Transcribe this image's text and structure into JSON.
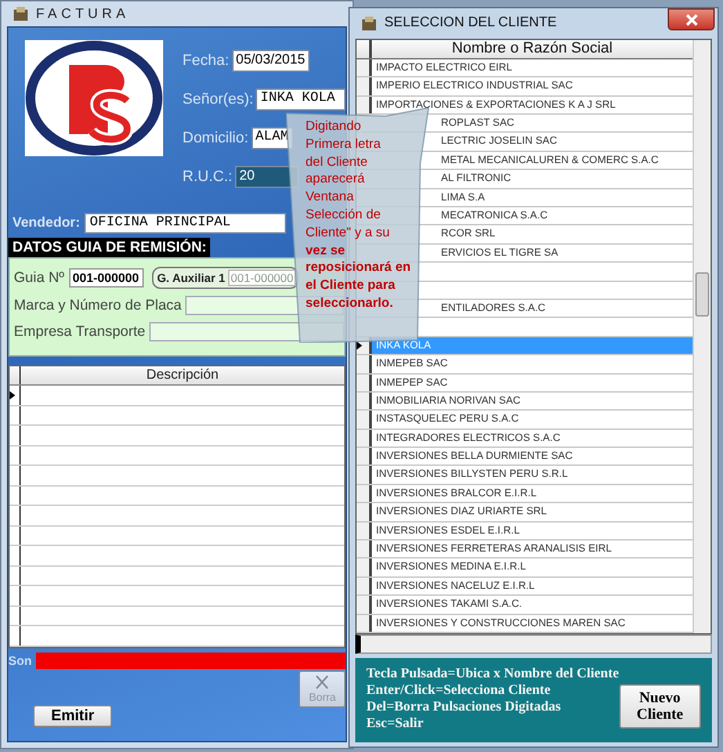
{
  "factura": {
    "title": "FACTURA",
    "fields": [
      {
        "label": "Fecha:",
        "value": "05/03/2015",
        "kind": "date"
      },
      {
        "label": "Señor(es):",
        "value": "INKA KOLA",
        "kind": "mono_wide"
      },
      {
        "label": "Domicilio:",
        "value": "ALAM",
        "kind": "mono"
      },
      {
        "label": "R.U.C.:",
        "value": "20",
        "kind": "highlighted"
      }
    ],
    "vendedor_label": "Vendedor:",
    "vendedor": "OFICINA PRINCIPAL",
    "guia": {
      "title": "DATOS GUIA DE REMISIÓN:",
      "guia_label": "Guia Nº",
      "guia": "001-000000",
      "auxiliar_label": "G. Auxiliar 1",
      "auxiliar": "001-000000",
      "placa_label": "Marca y Número de Placa",
      "transporte_label": "Empresa Transporte"
    },
    "table": {
      "columns": [
        "Descripción"
      ]
    },
    "son_label": "Son",
    "buttons": [
      {
        "label": "Emitir",
        "kind": "text"
      },
      {
        "label": "Borra",
        "kind": "icon"
      }
    ]
  },
  "dialog": {
    "title": "SELECCION DEL CLIENTE",
    "column": "Nombre o Razón Social",
    "rows": [
      {
        "text": "IMPACTO ELECTRICO EIRL",
        "selected": false
      },
      {
        "text": "IMPERIO ELECTRICO INDUSTRIAL SAC",
        "selected": false
      },
      {
        "text": "IMPORTACIONES & EXPORTACIONES K A J SRL",
        "selected": false
      },
      {
        "text": "ROPLAST SAC",
        "selected": false,
        "kind": "partly_hidden"
      },
      {
        "text": "LECTRIC JOSELIN SAC",
        "selected": false,
        "kind": "partly_hidden"
      },
      {
        "text": "METAL MECANICALUREN & COMERC S.A.C",
        "selected": false,
        "kind": "partly_hidden"
      },
      {
        "text": "AL FILTRONIC",
        "selected": false,
        "kind": "partly_hidden"
      },
      {
        "text": "LIMA S.A",
        "selected": false,
        "kind": "partly_hidden"
      },
      {
        "text": "MECATRONICA S.A.C",
        "selected": false,
        "kind": "partly_hidden"
      },
      {
        "text": "RCOR SRL",
        "selected": false,
        "kind": "partly_hidden"
      },
      {
        "text": "ERVICIOS EL TIGRE SA",
        "selected": false,
        "kind": "partly_hidden"
      },
      {
        "selected": false,
        "kind": "partly_hidden"
      },
      {
        "selected": false,
        "kind": "partly_hidden"
      },
      {
        "text": "ENTILADORES S.A.C",
        "selected": false,
        "kind": "partly_hidden"
      },
      {
        "selected": false,
        "kind": "partly_hidden"
      },
      {
        "text": "INKA KOLA",
        "selected": true
      },
      {
        "text": "INMEPEB SAC",
        "selected": false
      },
      {
        "text": "INMEPEP SAC",
        "selected": false
      },
      {
        "text": "INMOBILIARIA NORIVAN SAC",
        "selected": false
      },
      {
        "text": "INSTASQUELEC PERU S.A.C",
        "selected": false
      },
      {
        "text": "INTEGRADORES ELECTRICOS S.A.C",
        "selected": false
      },
      {
        "text": "INVERSIONES BELLA DURMIENTE SAC",
        "selected": false
      },
      {
        "text": "INVERSIONES BILLYSTEN PERU S.R.L",
        "selected": false
      },
      {
        "text": "INVERSIONES BRALCOR E.I.R.L",
        "selected": false
      },
      {
        "text": "INVERSIONES DIAZ URIARTE SRL",
        "selected": false
      },
      {
        "text": "INVERSIONES ESDEL E.I.R.L",
        "selected": false
      },
      {
        "text": "INVERSIONES FERRETERAS ARANALISIS EIRL",
        "selected": false
      },
      {
        "text": "INVERSIONES MEDINA E.I.R.L",
        "selected": false
      },
      {
        "text": "INVERSIONES NACELUZ E.I.R.L",
        "selected": false
      },
      {
        "text": "INVERSIONES TAKAMI S.A.C.",
        "selected": false
      },
      {
        "text": "INVERSIONES Y CONSTRUCCIONES MAREN SAC",
        "selected": false
      }
    ],
    "help_lines": [
      "Tecla Pulsada=Ubica x Nombre del Cliente",
      "Enter/Click=Selecciona Cliente",
      "Del=Borra Pulsaciones Digitadas",
      "Esc=Salir"
    ],
    "new_button": "Nuevo Cliente"
  },
  "callout": {
    "text": "Digitando\nPrimera letra\ndel Cliente\naparecerá\nVentana\nSelección de\nCliente\" y a su\n**vez se\nreposicionará en\nel Cliente para\nseleccionarlo.**"
  }
}
